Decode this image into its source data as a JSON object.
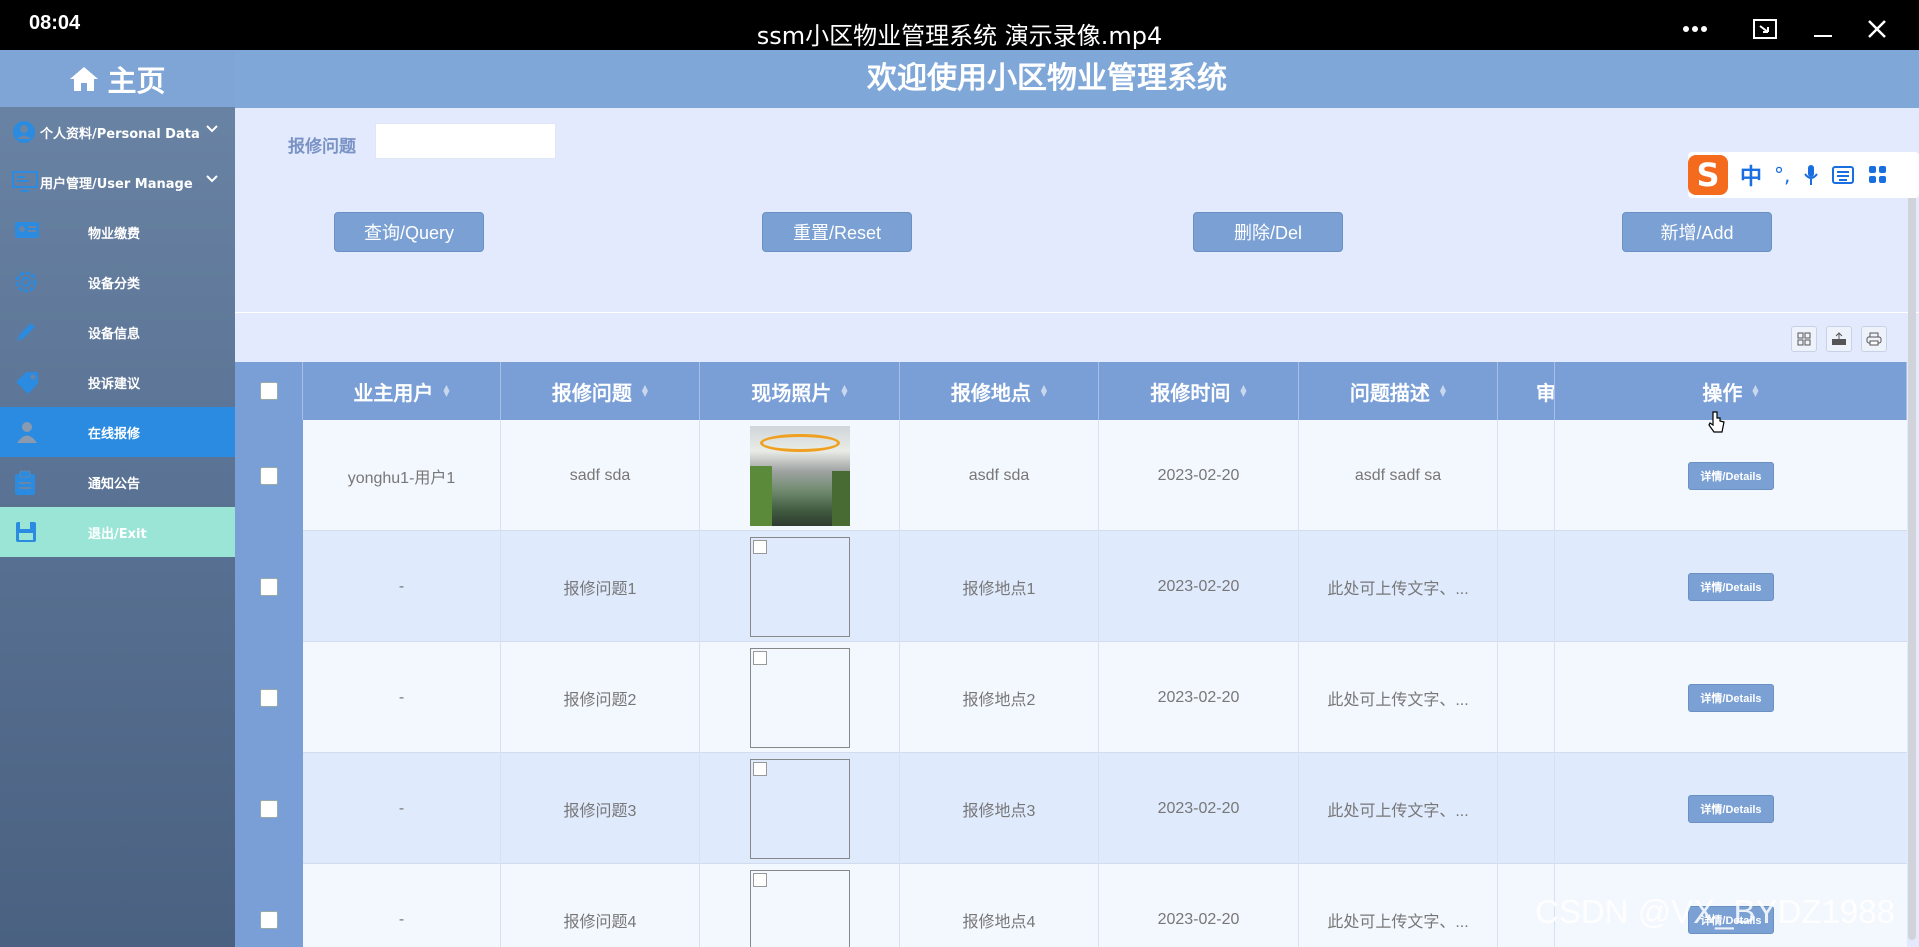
{
  "player": {
    "time": "08:04",
    "title": "ssm小区物业管理系统 演示录像.mp4"
  },
  "sidebar": {
    "home_label": "主页",
    "items": [
      {
        "label": "个人资料/Personal Data",
        "icon": "user-circle-icon",
        "expandable": true
      },
      {
        "label": "用户管理/User Manage",
        "icon": "monitor-icon",
        "expandable": true
      },
      {
        "label": "物业缴费",
        "icon": "id-card-icon"
      },
      {
        "label": "设备分类",
        "icon": "gear-icon"
      },
      {
        "label": "设备信息",
        "icon": "pen-icon"
      },
      {
        "label": "投诉建议",
        "icon": "tag-icon"
      },
      {
        "label": "在线报修",
        "icon": "people-icon",
        "active": true
      },
      {
        "label": "通知公告",
        "icon": "clipboard-icon"
      },
      {
        "label": "退出/Exit",
        "icon": "save-icon"
      }
    ]
  },
  "header": {
    "title": "欢迎使用小区物业管理系统"
  },
  "search": {
    "label": "报修问题",
    "value": ""
  },
  "buttons": {
    "query": "查询/Query",
    "reset": "重置/Reset",
    "delete": "删除/Del",
    "add": "新增/Add"
  },
  "table": {
    "columns": [
      "业主用户",
      "报修问题",
      "现场照片",
      "报修地点",
      "报修时间",
      "问题描述",
      "审",
      "操作"
    ],
    "rows": [
      {
        "owner": "yonghu1-用户1",
        "issue": "sadf sda",
        "photo": true,
        "location": "asdf sda",
        "time": "2023-02-20",
        "desc": "asdf sadf sa",
        "action": "详情/Details"
      },
      {
        "owner": "-",
        "issue": "报修问题1",
        "photo": false,
        "location": "报修地点1",
        "time": "2023-02-20",
        "desc": "此处可上传文字、...",
        "action": "详情/Details"
      },
      {
        "owner": "-",
        "issue": "报修问题2",
        "photo": false,
        "location": "报修地点2",
        "time": "2023-02-20",
        "desc": "此处可上传文字、...",
        "action": "详情/Details"
      },
      {
        "owner": "-",
        "issue": "报修问题3",
        "photo": false,
        "location": "报修地点3",
        "time": "2023-02-20",
        "desc": "此处可上传文字、...",
        "action": "详情/Details"
      },
      {
        "owner": "-",
        "issue": "报修问题4",
        "photo": false,
        "location": "报修地点4",
        "time": "2023-02-20",
        "desc": "此处可上传文字、...",
        "action": "详情/Details"
      }
    ]
  },
  "ime": {
    "logo": "S",
    "mode": "中"
  },
  "watermark": "CSDN @VX_BYDZ1988",
  "colors": {
    "accent": "#7aa0d4",
    "active": "#2a8be0",
    "exit": "#9be5d6"
  }
}
